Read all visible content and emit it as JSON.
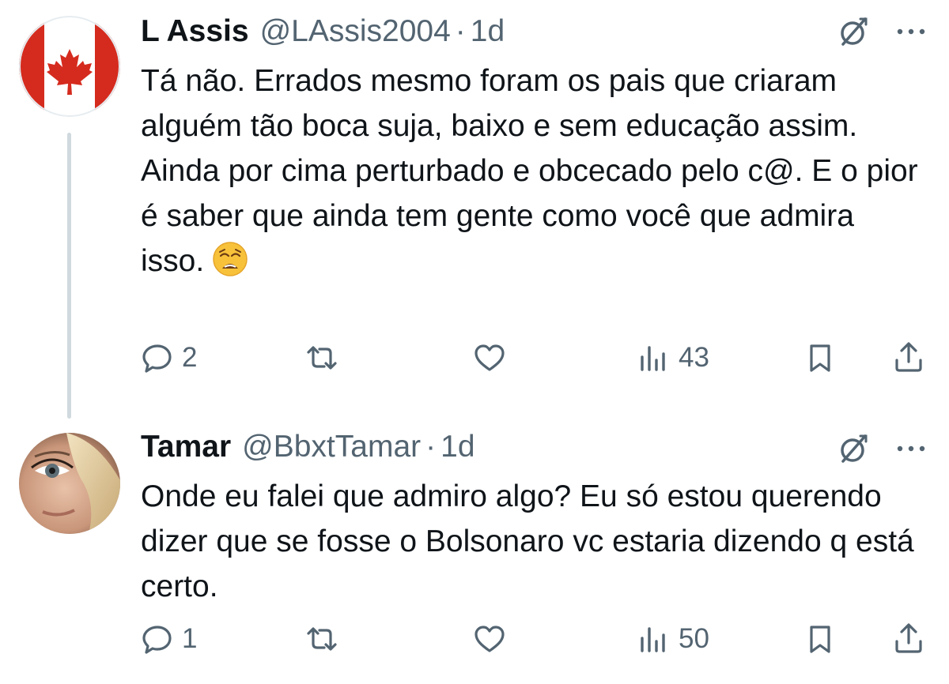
{
  "tweets": [
    {
      "author": {
        "display_name": "L Assis",
        "handle": "@LAssis2004",
        "avatar": "canada-flag-avatar"
      },
      "separator": "·",
      "time": "1d",
      "text": "Tá não. Errados mesmo foram os pais que criaram alguém tão boca suja, baixo e sem educação assim.\nAinda por cima perturbado e obcecado pelo c@. E o pior é saber que ainda tem gente como você que admira isso.",
      "emoji": "weary-face-emoji",
      "actions": {
        "replies": "2",
        "reposts": "",
        "likes": "",
        "views": "43"
      }
    },
    {
      "author": {
        "display_name": "Tamar",
        "handle": "@BbxtTamar",
        "avatar": "woman-portrait-avatar"
      },
      "separator": "·",
      "time": "1d",
      "text": "Onde eu falei que admiro algo? Eu só estou querendo dizer que se fosse o Bolsonaro vc estaria dizendo q está certo.",
      "actions": {
        "replies": "1",
        "reposts": "",
        "likes": "",
        "views": "50"
      }
    }
  ],
  "icons": {
    "reply": "reply-icon",
    "repost": "repost-icon",
    "like": "heart-icon",
    "views": "views-icon",
    "bookmark": "bookmark-icon",
    "share": "share-icon",
    "grok": "grok-icon",
    "more": "more-icon"
  },
  "colors": {
    "text": "#0f1419",
    "secondary": "#536471",
    "thread_line": "#cfd9de",
    "canada_red": "#d52b1e"
  }
}
